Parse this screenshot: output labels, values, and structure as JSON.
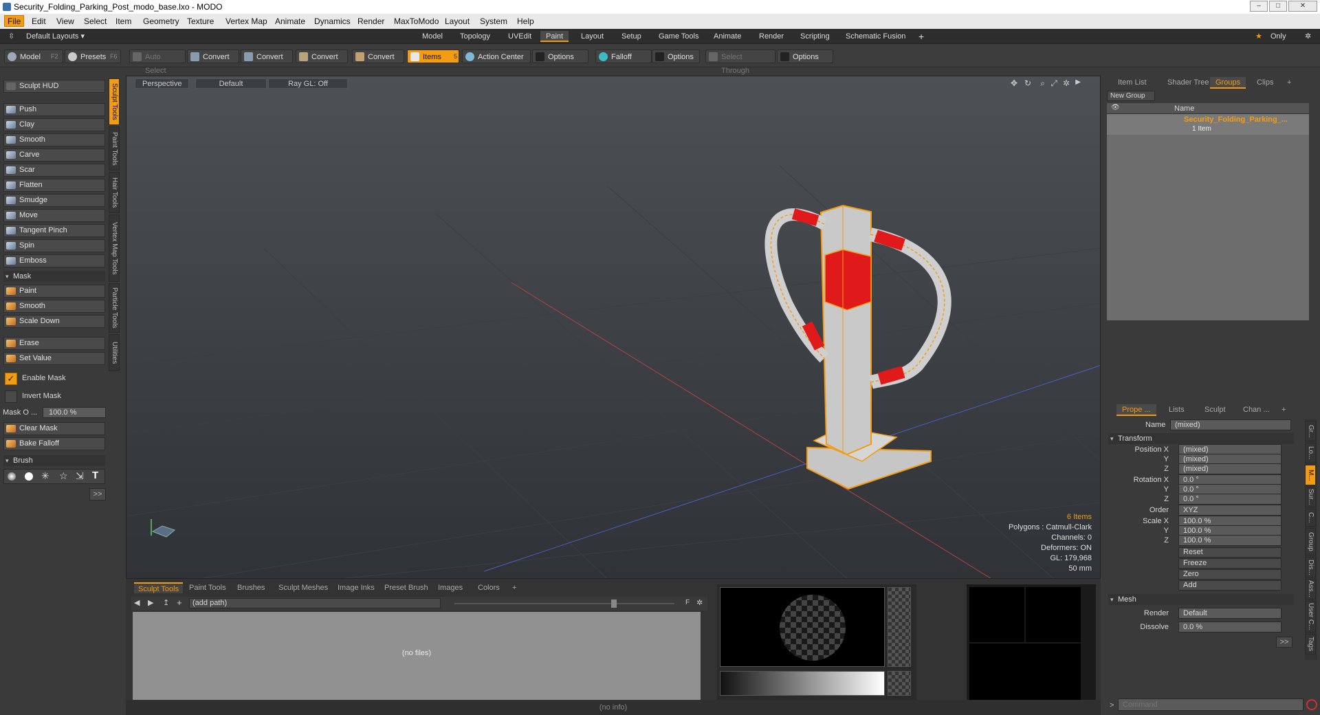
{
  "window": {
    "title": "Security_Folding_Parking_Post_modo_base.lxo - MODO"
  },
  "menu": [
    "File",
    "Edit",
    "View",
    "Select",
    "Item",
    "Geometry",
    "Texture",
    "Vertex Map",
    "Animate",
    "Dynamics",
    "Render",
    "MaxToModo",
    "Layout",
    "System",
    "Help"
  ],
  "layout": {
    "default_layouts": "Default Layouts ▾",
    "tabs": [
      "Model",
      "Topology",
      "UVEdit",
      "Paint",
      "Layout",
      "Setup",
      "Game Tools",
      "Animate",
      "Render",
      "Scripting",
      "Schematic Fusion"
    ],
    "active_tab": "Paint",
    "add": "+",
    "only": "Only"
  },
  "toolbar": {
    "model": "Model",
    "model_key": "F2",
    "presets": "Presets",
    "presets_key": "F6",
    "auto_select": "Auto Select",
    "convert1": "Convert",
    "convert2": "Convert",
    "convert3": "Convert",
    "convert4": "Convert",
    "items": "Items",
    "items_key": "5",
    "action_center": "Action Center",
    "options1": "Options",
    "falloff": "Falloff",
    "options2": "Options",
    "select_through": "Select Through",
    "options3": "Options"
  },
  "left": {
    "sculpt_hud": "Sculpt HUD",
    "tools": [
      "Push",
      "Clay",
      "Smooth",
      "Carve",
      "Scar",
      "Flatten",
      "Smudge",
      "Move",
      "Tangent Pinch",
      "Spin",
      "Emboss"
    ],
    "mask_section": "Mask",
    "mask_tools": [
      "Paint",
      "Smooth",
      "Scale Down"
    ],
    "erase": "Erase",
    "set_value": "Set Value",
    "enable_mask": "Enable Mask",
    "invert_mask": "Invert Mask",
    "mask_opacity_label": "Mask O ...",
    "mask_opacity_value": "100.0 %",
    "clear_mask": "Clear Mask",
    "bake_falloff": "Bake Falloff",
    "brush_section": "Brush",
    "more": ">>",
    "vtabs": [
      "Sculpt Tools",
      "Paint Tools",
      "Hair Tools",
      "Vertex Map Tools",
      "Particle Tools",
      "Utilities"
    ]
  },
  "viewport": {
    "view": "Perspective",
    "shading": "Default",
    "raygl": "Ray GL: Off",
    "stats": {
      "items": "6 Items",
      "polygons": "Polygons : Catmull-Clark",
      "channels": "Channels: 0",
      "deformers": "Deformers: ON",
      "gl": "GL: 179,968",
      "scale": "50 mm"
    }
  },
  "bottom": {
    "tabs": [
      "Sculpt Tools",
      "Paint Tools",
      "Brushes",
      "Sculpt Meshes",
      "Image Inks",
      "Preset Brush",
      "Images",
      "Colors",
      "+"
    ],
    "path": "(add path)",
    "no_files": "(no files)",
    "status": "(no info)",
    "f_label": "F"
  },
  "right": {
    "top_tabs": [
      "Item List",
      "Shader Tree",
      "Groups",
      "Clips",
      "+"
    ],
    "new_group": "New Group",
    "name_col": "Name",
    "group_name": "Security_Folding_Parking_...",
    "group_count": "1 Item",
    "prop_tabs": [
      "Prope ...",
      "Lists",
      "Sculpt",
      "Chan ...",
      "+"
    ],
    "name_label": "Name",
    "name_value": "(mixed)",
    "transform": "Transform",
    "position_x_label": "Position X",
    "y_label": "Y",
    "z_label": "Z",
    "mixed": "(mixed)",
    "rotation_x_label": "Rotation X",
    "rot_value": "0.0 °",
    "order_label": "Order",
    "order_value": "XYZ",
    "scale_x_label": "Scale X",
    "scale_value": "100.0 %",
    "reset": "Reset",
    "freeze": "Freeze",
    "zero": "Zero",
    "add": "Add",
    "mesh": "Mesh",
    "render_label": "Render",
    "render_value": "Default",
    "dissolve_label": "Dissolve",
    "dissolve_value": "0.0 %",
    "more": ">>",
    "command_placeholder": "Command",
    "side_tabs": [
      "Gr...",
      "Lo...",
      "M...",
      "Sur...",
      "C...",
      "Group",
      "Dis...",
      "Ass...",
      "User C...",
      "Tags"
    ]
  },
  "colors": {
    "accent": "#f39c12",
    "red": "#e02020"
  }
}
